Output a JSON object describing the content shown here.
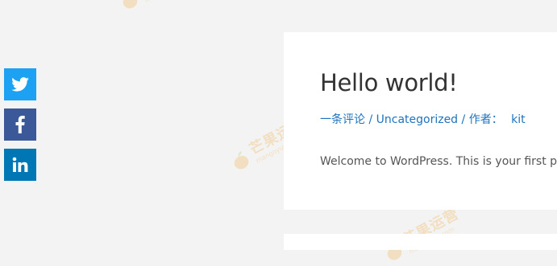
{
  "share": {
    "buttons": [
      {
        "network": "twitter",
        "icon": "twitter-icon",
        "color": "#1da1f2"
      },
      {
        "network": "facebook",
        "icon": "facebook-icon",
        "color": "#3b5998"
      },
      {
        "network": "linkedin",
        "icon": "linkedin-icon",
        "color": "#0077b5"
      }
    ]
  },
  "post": {
    "title": "Hello world!",
    "meta": {
      "comments": "一条评论",
      "separator": "/",
      "category": "Uncategorized",
      "author_prefix": "作者：",
      "author": "kit"
    },
    "excerpt": "Welcome to WordPress. This is your first post. Edit or delete it, then start writing!"
  },
  "watermark": {
    "text_cn": "芒果运营",
    "text_en": "mangoyun.com"
  },
  "colors": {
    "background": "#f3f3f3",
    "card": "#ffffff",
    "link": "#1e73be",
    "title": "#333333",
    "body": "#555555",
    "watermark": "#f29b16"
  }
}
